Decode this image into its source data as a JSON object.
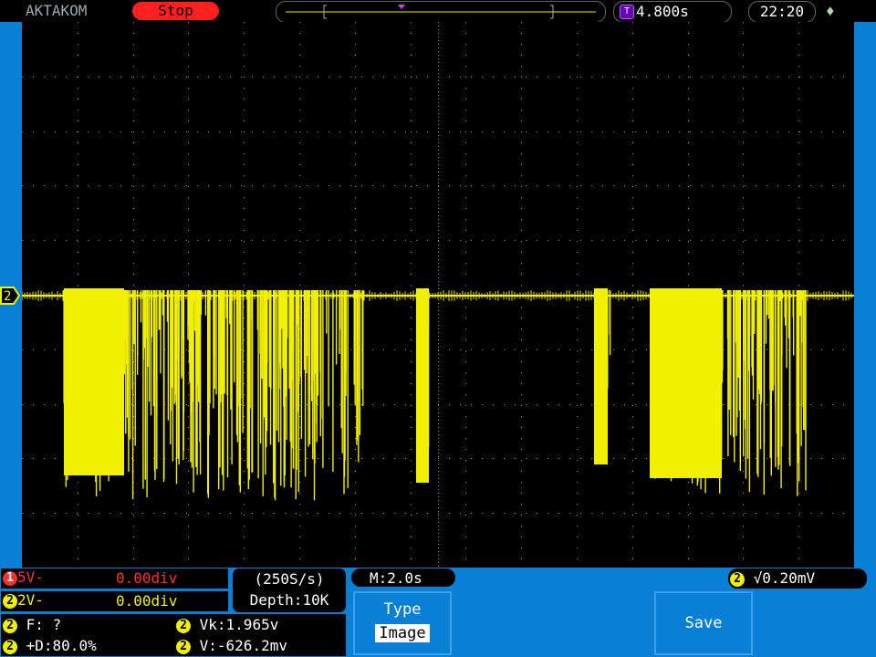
{
  "topbar": {
    "brand": "AKTAKOM",
    "run_state": "Stop",
    "trigger_time": "4.800s",
    "clock": "22:20"
  },
  "colors": {
    "frame": "#0a7fd6",
    "ch1": "#ff2d2d",
    "ch2": "#f0f000",
    "grid": "#9a9a9a"
  },
  "channels": {
    "ch1": {
      "num": "1",
      "scale": "5V-",
      "offset": "0.00div"
    },
    "ch2": {
      "num": "2",
      "scale": "2V-",
      "offset": "0.00div"
    }
  },
  "acquisition": {
    "rate": "(250S/s)",
    "depth": "Depth:10K"
  },
  "timebase": {
    "label": "M:2.0s"
  },
  "trigger": {
    "channel": "2",
    "level": "0.20mV"
  },
  "measurements": {
    "freq": "F:  ?",
    "duty": "+D:80.0%",
    "vk": "Vk:1.965v",
    "v": "V:-626.2mv"
  },
  "softkeys": {
    "type_label": "Type",
    "type_value": "Image",
    "save_label": "Save"
  },
  "trace": {
    "channel_marker": "2"
  }
}
